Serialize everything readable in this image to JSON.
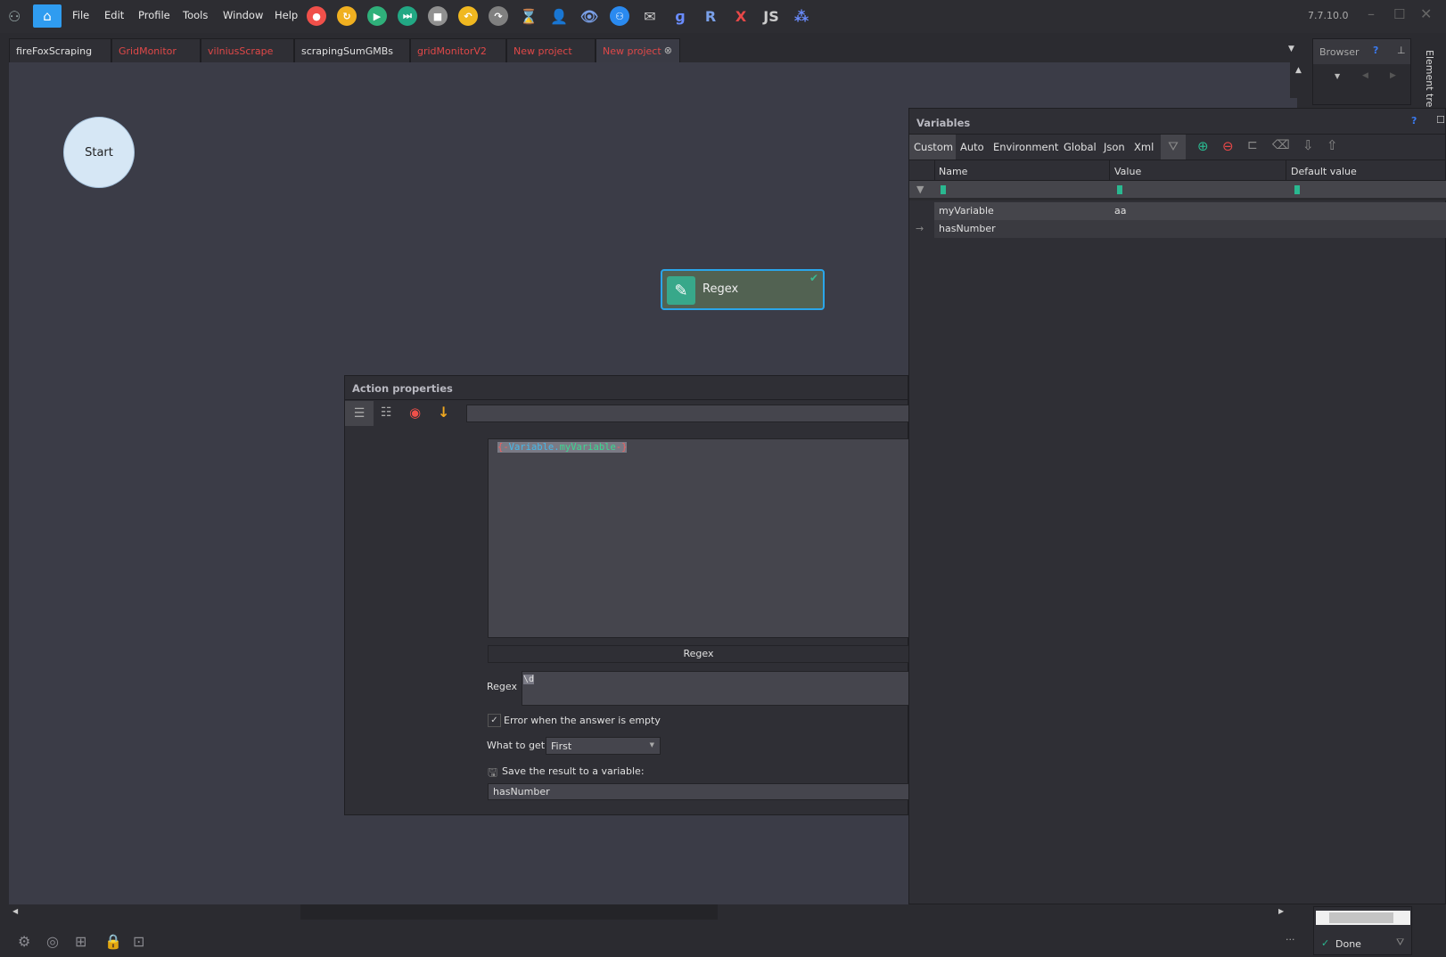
{
  "menu": [
    "File",
    "Edit",
    "Profile",
    "Tools",
    "Window",
    "Help"
  ],
  "version": "7.7.10.0",
  "toolbar_icons": [
    {
      "name": "record-icon",
      "color": "#f0504a",
      "glyph": "●"
    },
    {
      "name": "refresh-icon",
      "color": "#f0b020",
      "glyph": "↻"
    },
    {
      "name": "play-icon",
      "color": "#2fb07a",
      "glyph": "▶"
    },
    {
      "name": "step-icon",
      "color": "#22a884",
      "glyph": "⏭"
    },
    {
      "name": "stop-icon",
      "color": "#909090",
      "glyph": "■"
    },
    {
      "name": "undo-icon",
      "color": "#f0b820",
      "glyph": "↶"
    },
    {
      "name": "redo-icon",
      "color": "#808080",
      "glyph": "↷"
    },
    {
      "name": "hourglass-icon",
      "color": "transparent",
      "glyph": "⌛"
    },
    {
      "name": "user-icon",
      "color": "transparent",
      "glyph": "👤"
    },
    {
      "name": "eye-icon",
      "color": "transparent",
      "glyph": "👁"
    },
    {
      "name": "network-icon",
      "color": "#2a8af0",
      "glyph": "⚇"
    },
    {
      "name": "mail-icon",
      "color": "transparent",
      "glyph": "✉"
    },
    {
      "name": "regex-icon",
      "color": "transparent",
      "glyph": "ɡ"
    },
    {
      "name": "r-icon",
      "color": "transparent",
      "glyph": "R"
    },
    {
      "name": "x-icon",
      "color": "transparent",
      "glyph": "X"
    },
    {
      "name": "js-icon",
      "color": "transparent",
      "glyph": "JS"
    },
    {
      "name": "wand-icon",
      "color": "transparent",
      "glyph": "⁂"
    }
  ],
  "tabs": [
    {
      "label": "fireFoxScraping",
      "red": false
    },
    {
      "label": "GridMonitor",
      "red": true
    },
    {
      "label": "vilniusScrape",
      "red": true
    },
    {
      "label": "scrapingSumGMBs",
      "red": false
    },
    {
      "label": "gridMonitorV2",
      "red": true
    },
    {
      "label": "New project",
      "red": true
    },
    {
      "label": "New project",
      "red": true,
      "active": true
    }
  ],
  "canvas": {
    "start_label": "Start",
    "node_label": "Regex"
  },
  "browser": {
    "title": "Browser",
    "help": "?",
    "element_tree": "Element tree"
  },
  "action": {
    "title": "Action properties",
    "text_value_parts": [
      "{-",
      "Variable.",
      "myVariable",
      "-}"
    ],
    "section_button": "Regex",
    "regex_label": "Regex",
    "regex_value": "\\d",
    "error_checkbox": {
      "label": "Error  when the answer is empty",
      "checked": true
    },
    "what_to_get_label": "What to get",
    "what_to_get_value": "First",
    "save_label": "Save the result to a variable:",
    "save_value": "hasNumber"
  },
  "variables": {
    "title": "Variables",
    "help": "?",
    "tabs": [
      "Custom",
      "Auto",
      "Environment",
      "Global",
      "Json",
      "Xml"
    ],
    "columns": [
      "Name",
      "Value",
      "Default value"
    ],
    "rows": [
      {
        "name": "myVariable",
        "value": "aa",
        "default": ""
      },
      {
        "name": "hasNumber",
        "value": "",
        "default": ""
      }
    ]
  },
  "status": {
    "done": "Done",
    "more": "···"
  }
}
